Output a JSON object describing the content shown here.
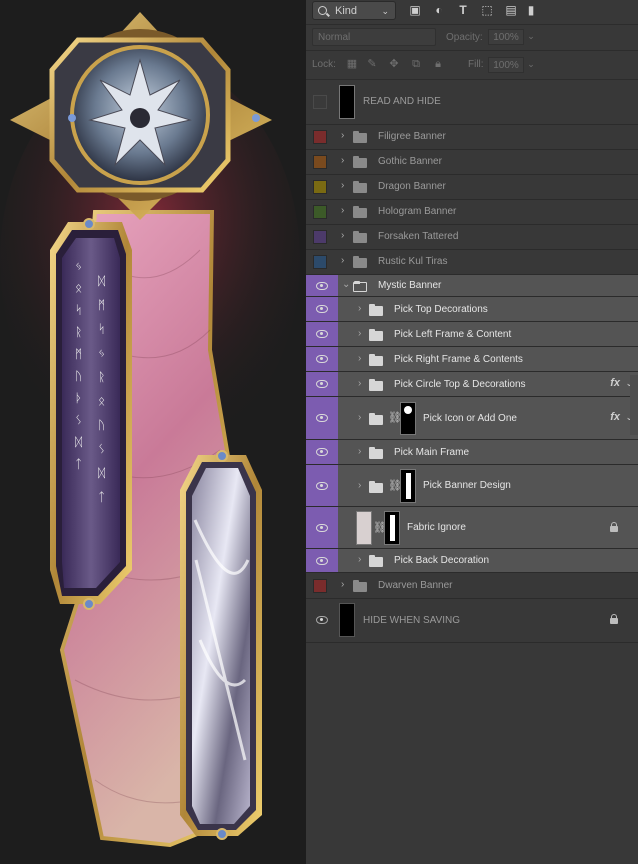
{
  "filter": {
    "kind_label": "Kind",
    "icons": [
      "image-filter-icon",
      "adjustment-filter-icon",
      "type-filter-icon",
      "shape-filter-icon",
      "smart-object-filter-icon",
      "toggle-filter-icon"
    ]
  },
  "blend": {
    "mode": "Normal",
    "opacity_label": "Opacity:",
    "opacity_value": "100%",
    "lock_label": "Lock:",
    "fill_label": "Fill:",
    "fill_value": "100%"
  },
  "layers": [
    {
      "name": "READ AND HIDE",
      "type": "text-thumb",
      "visible": false
    },
    {
      "name": "Filigree Banner",
      "type": "group",
      "color": "#7a2c2c",
      "visible": false
    },
    {
      "name": "Gothic Banner",
      "type": "group",
      "color": "#7a4a1e",
      "visible": false
    },
    {
      "name": "Dragon Banner",
      "type": "group",
      "color": "#7a6a12",
      "visible": false
    },
    {
      "name": "Hologram Banner",
      "type": "group",
      "color": "#3c5a28",
      "visible": false
    },
    {
      "name": "Forsaken Tattered",
      "type": "group",
      "color": "#4c3a6a",
      "visible": false
    },
    {
      "name": "Rustic Kul Tiras",
      "type": "group",
      "color": "#2c4a6a",
      "visible": false
    },
    {
      "name": "Mystic Banner",
      "type": "group-open",
      "visible": true
    },
    {
      "name": "Pick Top Decorations",
      "type": "sub-group",
      "visible": true
    },
    {
      "name": "Pick Left Frame & Content",
      "type": "sub-group",
      "visible": true
    },
    {
      "name": "Pick Right Frame & Contents",
      "type": "sub-group",
      "visible": true
    },
    {
      "name": "Pick Circle Top & Decorations",
      "type": "sub-group",
      "visible": true,
      "fx": "fx"
    },
    {
      "name": "Pick Icon or Add One",
      "type": "sub-group-mask",
      "visible": true,
      "fx": "fx"
    },
    {
      "name": "Pick Main Frame",
      "type": "sub-group",
      "visible": true
    },
    {
      "name": "Pick Banner Design",
      "type": "sub-group-mask",
      "visible": true
    },
    {
      "name": "Fabric Ignore",
      "type": "layer-mask",
      "visible": true,
      "locked": true
    },
    {
      "name": "Pick Back Decoration",
      "type": "sub-group",
      "visible": true
    },
    {
      "name": "Dwarven Banner",
      "type": "group",
      "color": "#7a2c2c",
      "visible": false
    },
    {
      "name": "HIDE WHEN SAVING",
      "type": "black-thumb",
      "visible": true,
      "locked": true
    }
  ],
  "colors": {
    "mystic_purple": "#7c5cb0",
    "panel_bg": "#383838"
  },
  "artwork": {
    "left_runes": [
      "ᛃ",
      "ᛟ",
      "ᛋ",
      "ᚱ",
      "ᛗ",
      "ᚢ",
      "ᚦ",
      "ᛊ",
      "ᛞ",
      "ᛏ"
    ],
    "left_runes2": [
      "ᛞ",
      "ᛗ",
      "ᛋ",
      "ᛃ",
      "ᚱ",
      "ᛟ",
      "ᚢ",
      "ᛊ",
      "ᛞ",
      "ᛏ"
    ]
  }
}
